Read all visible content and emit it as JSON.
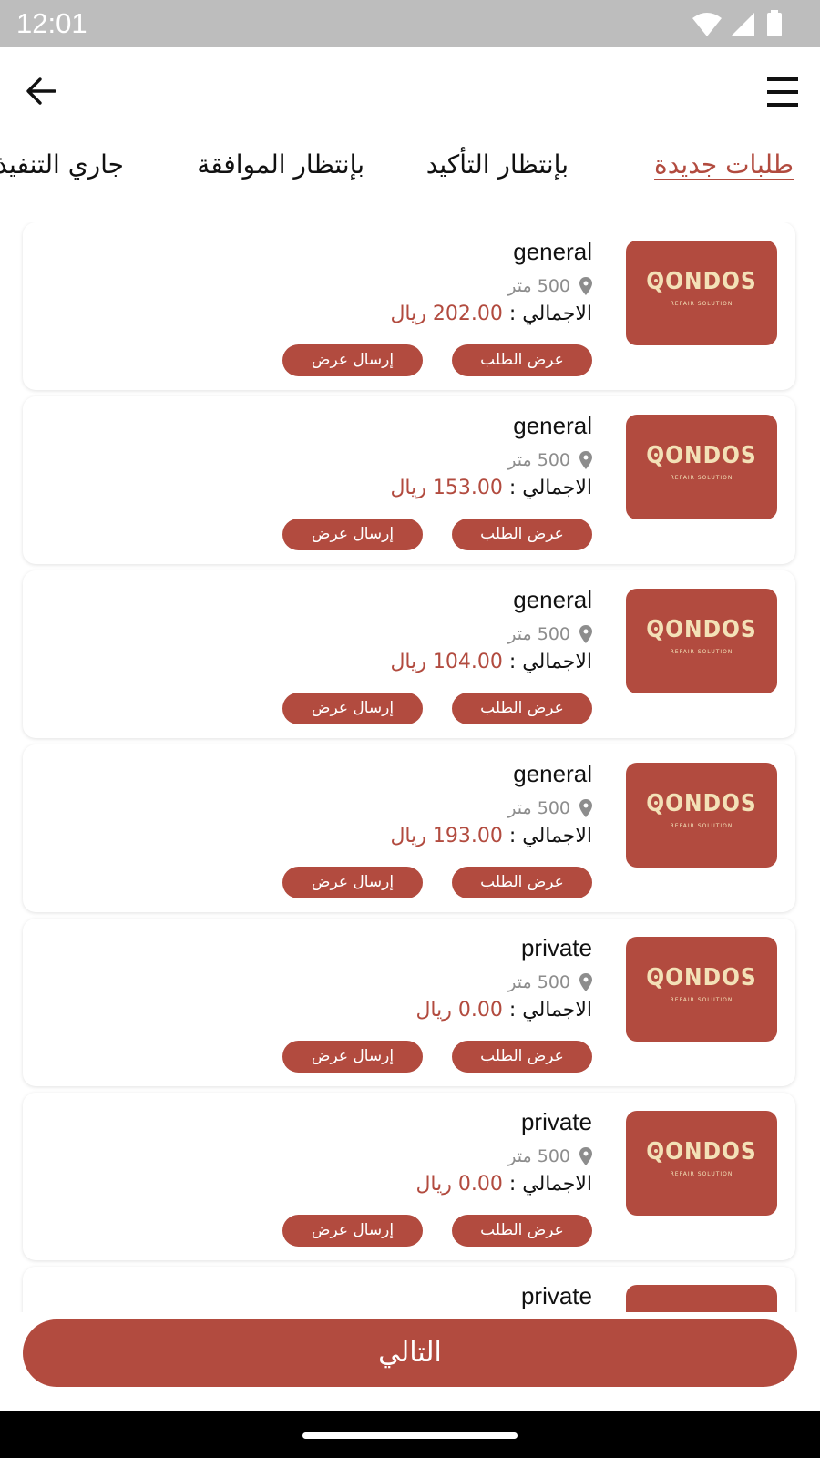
{
  "status_bar": {
    "time": "12:01"
  },
  "tabs": [
    {
      "label": "طلبات جديدة",
      "active": true
    },
    {
      "label": "بإنتظار التأكيد",
      "active": false
    },
    {
      "label": "بإنتظار الموافقة",
      "active": false
    },
    {
      "label": "جاري التنفيذ",
      "active": false
    }
  ],
  "logo": {
    "word": "QONDOS",
    "sub": "REPAIR SOLUTION"
  },
  "orders": [
    {
      "title": "general",
      "distance": "500 متر",
      "total_label": "الاجمالي :",
      "price": "202.00 ريال",
      "view_label": "عرض الطلب",
      "send_label": "إرسال عرض"
    },
    {
      "title": "general",
      "distance": "500 متر",
      "total_label": "الاجمالي :",
      "price": "153.00 ريال",
      "view_label": "عرض الطلب",
      "send_label": "إرسال عرض"
    },
    {
      "title": "general",
      "distance": "500 متر",
      "total_label": "الاجمالي :",
      "price": "104.00 ريال",
      "view_label": "عرض الطلب",
      "send_label": "إرسال عرض"
    },
    {
      "title": "general",
      "distance": "500 متر",
      "total_label": "الاجمالي :",
      "price": "193.00 ريال",
      "view_label": "عرض الطلب",
      "send_label": "إرسال عرض"
    },
    {
      "title": "private",
      "distance": "500 متر",
      "total_label": "الاجمالي :",
      "price": "0.00 ريال",
      "view_label": "عرض الطلب",
      "send_label": "إرسال عرض"
    },
    {
      "title": "private",
      "distance": "500 متر",
      "total_label": "الاجمالي :",
      "price": "0.00 ريال",
      "view_label": "عرض الطلب",
      "send_label": "إرسال عرض"
    },
    {
      "title": "private",
      "distance": "",
      "total_label": "",
      "price": "",
      "view_label": "",
      "send_label": ""
    }
  ],
  "next_button": {
    "label": "التالي"
  },
  "colors": {
    "accent": "#b24b3f",
    "logo_text": "#f3e1b7",
    "status_bar": "#bdbdbd"
  }
}
